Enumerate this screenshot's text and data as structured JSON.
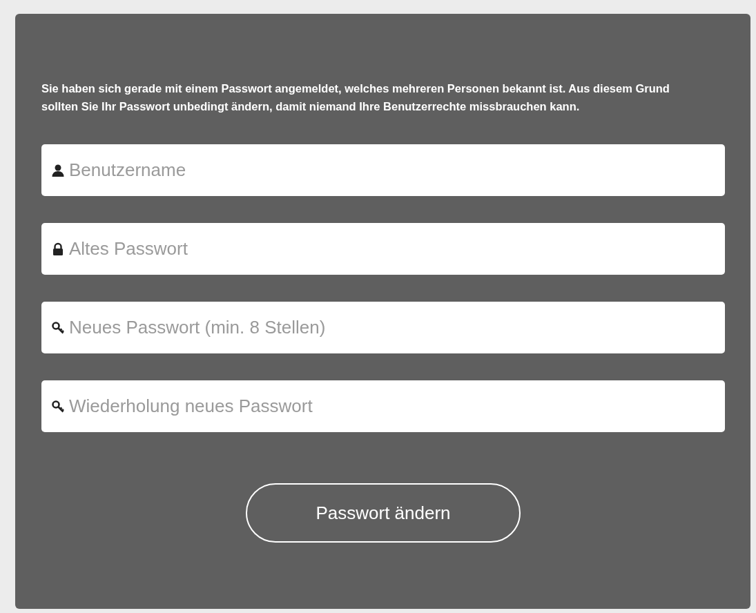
{
  "notice": "Sie haben sich gerade mit einem Passwort angemeldet, welches mehreren Personen bekannt ist. Aus diesem Grund sollten Sie Ihr Passwort unbedingt ändern, damit niemand Ihre Benutzerrechte missbrauchen kann.",
  "fields": [
    {
      "kind": "user",
      "placeholder": "Benutzername"
    },
    {
      "kind": "lock",
      "placeholder": "Altes Passwort"
    },
    {
      "kind": "key",
      "placeholder": "Neues Passwort (min. 8 Stellen)"
    },
    {
      "kind": "key",
      "placeholder": "Wiederholung neues Passwort"
    }
  ],
  "submit_button": "Passwort ändern"
}
